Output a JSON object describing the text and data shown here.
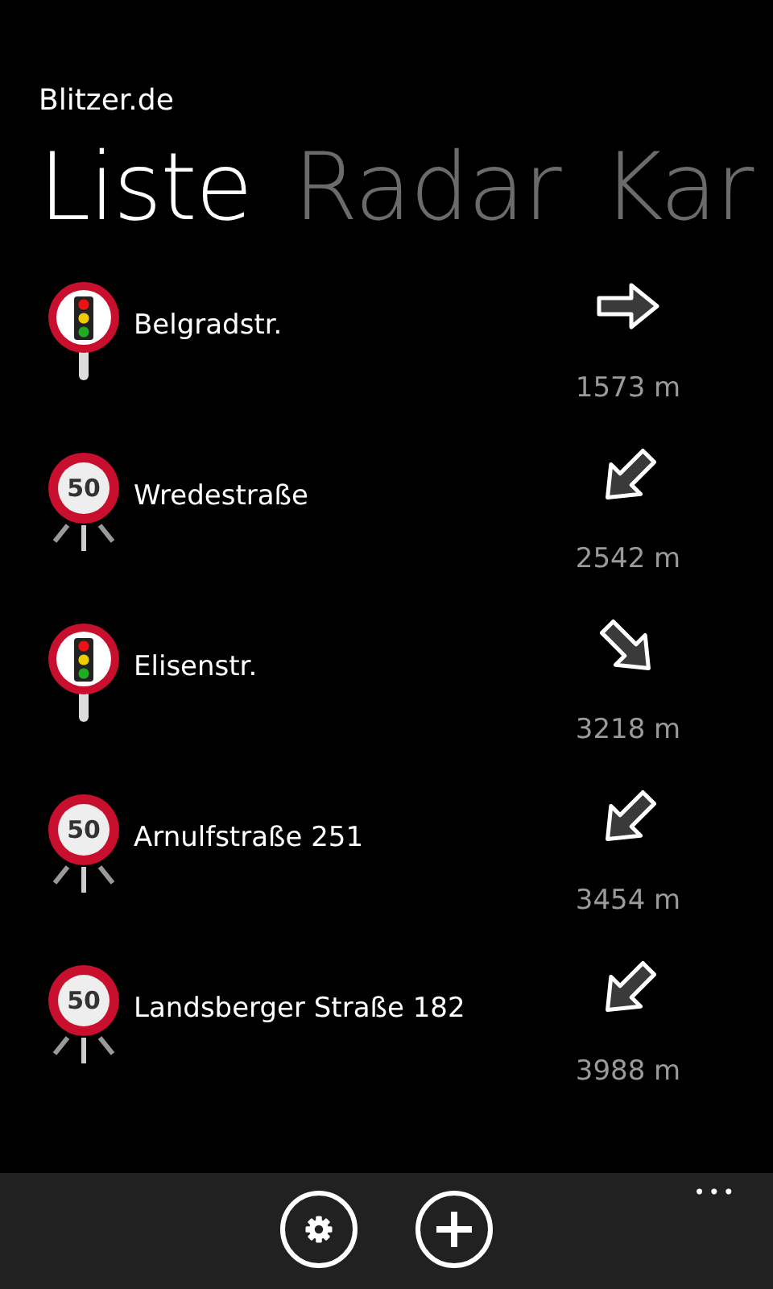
{
  "app_title": "Blitzer.de",
  "pivot": [
    {
      "label": "Liste",
      "selected": true
    },
    {
      "label": "Radar",
      "selected": false
    },
    {
      "label": "Kar",
      "selected": false
    }
  ],
  "items": [
    {
      "kind": "traffic-light",
      "name": "Belgradstr.",
      "arrow": {
        "kind": "e"
      },
      "distance": "1573 m"
    },
    {
      "kind": "speed",
      "limit": "50",
      "name": "Wredestraße",
      "arrow": {
        "kind": "sw"
      },
      "distance": "2542 m"
    },
    {
      "kind": "traffic-light",
      "name": "Elisenstr.",
      "arrow": {
        "kind": "se"
      },
      "distance": "3218 m"
    },
    {
      "kind": "speed",
      "limit": "50",
      "name": "Arnulfstraße 251",
      "arrow": {
        "kind": "sw"
      },
      "distance": "3454 m"
    },
    {
      "kind": "speed",
      "limit": "50",
      "name": "Landsberger Straße 182",
      "arrow": {
        "kind": "sw"
      },
      "distance": "3988 m"
    }
  ],
  "app_bar": {
    "buttons": [
      {
        "kind": "settings"
      },
      {
        "kind": "add"
      }
    ],
    "more": "•••"
  }
}
